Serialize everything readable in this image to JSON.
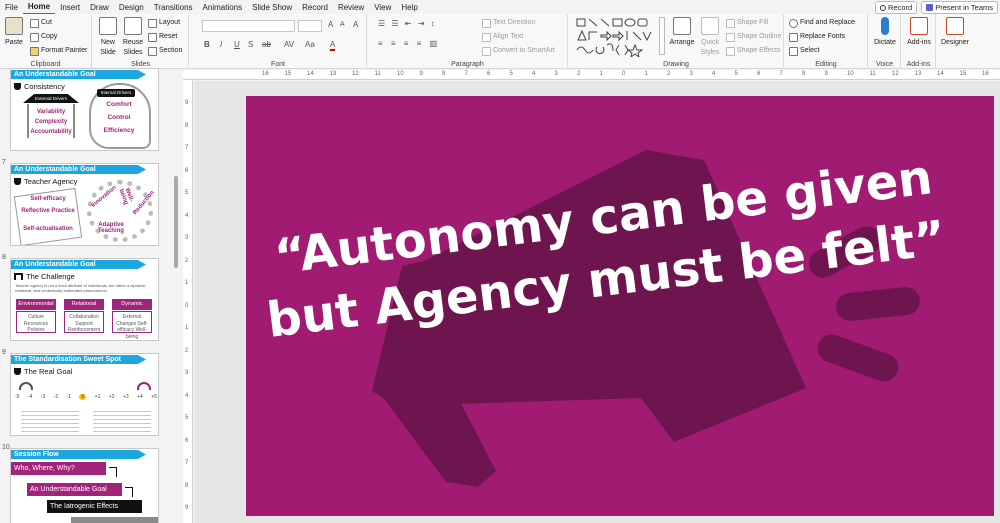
{
  "menu": {
    "tabs": [
      "File",
      "Home",
      "Insert",
      "Draw",
      "Design",
      "Transitions",
      "Animations",
      "Slide Show",
      "Record",
      "Review",
      "View",
      "Help"
    ],
    "active": "Home"
  },
  "top_right": {
    "record": "Record",
    "present": "Present in Teams"
  },
  "ribbon": {
    "clipboard": {
      "paste": "Paste",
      "cut": "Cut",
      "copy": "Copy",
      "format_painter": "Format Painter",
      "label": "Clipboard"
    },
    "slides": {
      "new_slide": "New Slide",
      "reuse_slides": "Reuse Slides",
      "layout": "Layout",
      "reset": "Reset",
      "section": "Section",
      "label": "Slides"
    },
    "font": {
      "label": "Font",
      "buttons": [
        "B",
        "I",
        "U",
        "S",
        "ab",
        "AV",
        "Aa",
        "A"
      ]
    },
    "paragraph": {
      "text_direction": "Text Direction",
      "align_text": "Align Text",
      "convert_smartart": "Convert to SmartArt",
      "label": "Paragraph"
    },
    "drawing": {
      "arrange": "Arrange",
      "quick_styles": "Quick Styles",
      "shape_fill": "Shape Fill",
      "shape_outline": "Shape Outline",
      "shape_effects": "Shape Effects",
      "label": "Drawing"
    },
    "editing": {
      "find_replace": "Find and Replace",
      "replace_fonts": "Replace Fonts",
      "select": "Select",
      "label": "Editing"
    },
    "voice": {
      "dictate": "Dictate",
      "label": "Voice"
    },
    "addins": {
      "addins": "Add-ins",
      "label": "Add-ins"
    },
    "designer": {
      "designer": "Designer"
    }
  },
  "slides": [
    {
      "banner": "An Understandable Goal",
      "title": "Consistency",
      "external": "External Drivers",
      "internal": "Internal Drivers",
      "ext_items": [
        "Variability",
        "Complexity",
        "Accountability"
      ],
      "int_items": [
        "Comfort",
        "Control",
        "Efficiency"
      ]
    },
    {
      "num": "7",
      "banner": "An Understandable Goal",
      "title": "Teacher Agency",
      "book_items": [
        "Self-efficacy",
        "Reflective Practice",
        "Self-actualisation"
      ],
      "gear_items": [
        "Innovation",
        "Well-being",
        "Adaptive Teaching",
        "Reduction"
      ]
    },
    {
      "num": "8",
      "banner": "An Understandable Goal",
      "title": "The Challenge",
      "intro": "Teacher agency is not a fixed attribute of individuals, but rather a dynamic, relational, and contextually embedded phenomenon.",
      "cols": [
        {
          "head": "Environmental",
          "body": "Culture Resources Policies"
        },
        {
          "head": "Relational",
          "body": "Collaboration Support Reinforcement"
        },
        {
          "head": "Dynamic",
          "body": "External Changes Self-efficacy Well-being"
        }
      ]
    },
    {
      "num": "9",
      "banner": "The Standardisation Sweet Spot",
      "title": "The Real Goal",
      "scale": [
        "-5",
        "-4",
        "-3",
        "-2",
        "-1",
        "0",
        "+1",
        "+2",
        "+3",
        "+4",
        "+5"
      ]
    },
    {
      "num": "10",
      "banner": "Session Flow",
      "flow": [
        "Who, Where, Why?",
        "An Understandable Goal",
        "The Iatrogenic Effects"
      ]
    }
  ],
  "main_slide": {
    "quote_line1": "“Autonomy can be given",
    "quote_line2": "but Agency must be felt”"
  },
  "colors": {
    "slide_bg": "#a21b72",
    "megaphone": "#6e1550",
    "accent_blue": "#1ca8dd",
    "accent_magenta": "#a1237a"
  },
  "ruler": {
    "top": [
      "16",
      "15",
      "14",
      "13",
      "12",
      "11",
      "10",
      "9",
      "8",
      "7",
      "6",
      "5",
      "4",
      "3",
      "2",
      "1",
      "0",
      "1",
      "2",
      "3",
      "4",
      "5",
      "6",
      "7",
      "8",
      "9",
      "10",
      "11",
      "12",
      "13",
      "14",
      "15",
      "16"
    ],
    "left": [
      "9",
      "8",
      "7",
      "6",
      "5",
      "4",
      "3",
      "2",
      "1",
      "0",
      "1",
      "2",
      "3",
      "4",
      "5",
      "6",
      "7",
      "8",
      "9"
    ]
  }
}
